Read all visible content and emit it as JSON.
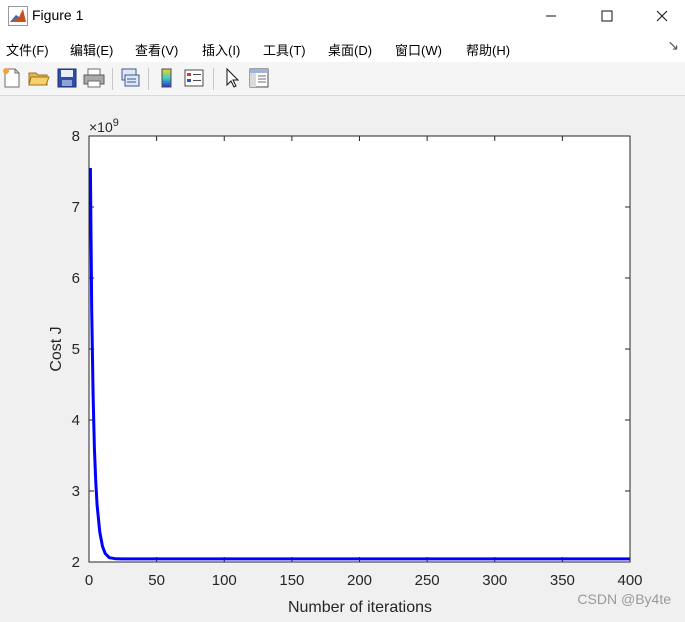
{
  "window": {
    "title": "Figure 1",
    "controls": [
      "minimize",
      "maximize",
      "close"
    ]
  },
  "menu": [
    {
      "label": "文件(F)"
    },
    {
      "label": "编辑(E)"
    },
    {
      "label": "查看(V)"
    },
    {
      "label": "插入(I)"
    },
    {
      "label": "工具(T)"
    },
    {
      "label": "桌面(D)"
    },
    {
      "label": "窗口(W)"
    },
    {
      "label": "帮助(H)"
    }
  ],
  "toolbar": {
    "icons": [
      "new-figure-icon",
      "open-file-icon",
      "save-icon",
      "print-icon",
      "link-plot-icon",
      "insert-colorbar-icon",
      "insert-legend-icon",
      "edit-plot-cursor-icon",
      "property-inspector-icon"
    ]
  },
  "watermark": "CSDN @By4te",
  "chart_data": {
    "type": "line",
    "title": "",
    "xlabel": "Number of iterations",
    "ylabel": "Cost J",
    "y_multiplier": "×10",
    "y_exponent": "9",
    "xlim": [
      0,
      400
    ],
    "ylim": [
      2,
      8
    ],
    "xticks": [
      "0",
      "50",
      "100",
      "150",
      "200",
      "250",
      "300",
      "350",
      "400"
    ],
    "yticks": [
      "2",
      "3",
      "4",
      "5",
      "6",
      "7",
      "8"
    ],
    "grid": false,
    "legend": "none",
    "series": [
      {
        "color": "#0000ff",
        "x": [
          1,
          2,
          3,
          4,
          5,
          6,
          8,
          10,
          12,
          15,
          20,
          25,
          30,
          50,
          100,
          200,
          300,
          400
        ],
        "y": [
          7.55,
          5.55,
          4.35,
          3.6,
          3.12,
          2.8,
          2.42,
          2.22,
          2.12,
          2.06,
          2.045,
          2.043,
          2.043,
          2.043,
          2.043,
          2.043,
          2.043,
          2.043
        ]
      }
    ]
  }
}
